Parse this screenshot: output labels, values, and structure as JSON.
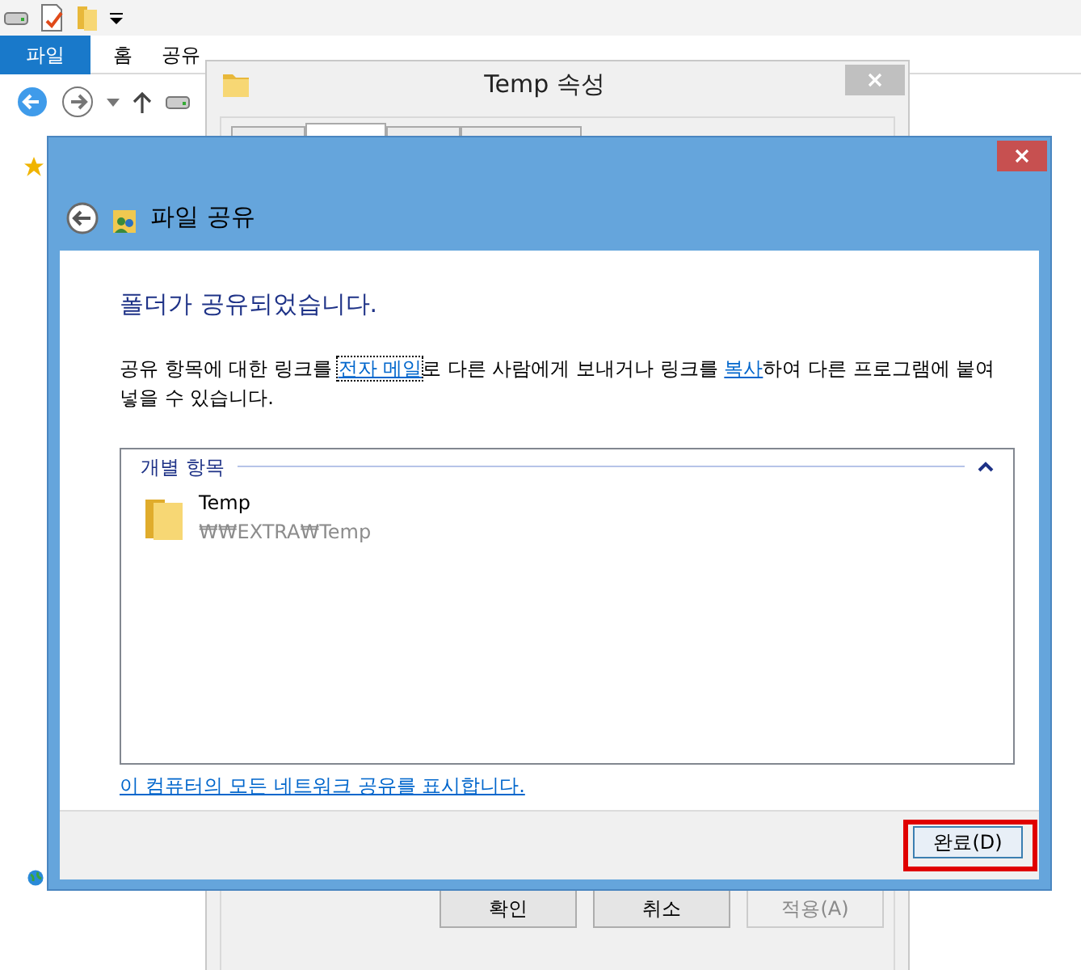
{
  "explorer": {
    "ribbon_tabs": [
      {
        "label": "파일",
        "selected": true
      },
      {
        "label": "홈",
        "selected": false
      },
      {
        "label": "공유",
        "selected": false
      }
    ]
  },
  "properties": {
    "title": "Temp 속성",
    "tabs": [
      {
        "selected": false
      },
      {
        "selected": true
      },
      {
        "selected": false
      },
      {
        "selected": false
      }
    ],
    "buttons": [
      {
        "label": "확인",
        "disabled": false
      },
      {
        "label": "취소",
        "disabled": false
      },
      {
        "label": "적용(A)",
        "disabled": true
      }
    ]
  },
  "sharing": {
    "title": "파일 공유",
    "heading": "폴더가 공유되었습니다.",
    "message": [
      {
        "kind": "text",
        "text": "공유 항목에 대한 링크를 "
      },
      {
        "kind": "link",
        "text": "전자 메일",
        "focused": true
      },
      {
        "kind": "text",
        "text": "로 다른 사람에게 보내거나 링크를 "
      },
      {
        "kind": "link",
        "text": "복사",
        "focused": false
      },
      {
        "kind": "text",
        "text": "하여 다른 프로그램에 붙여넣을 수 있습니다."
      }
    ],
    "group": {
      "label": "개별 항목",
      "expanded": true,
      "items": [
        {
          "name": "Temp",
          "path": "₩₩EXTRA₩Temp"
        }
      ]
    },
    "footer_link": "이 컴퓨터의 모든 네트워크 공유를 표시합니다.",
    "done_button": {
      "label": "완료(D)",
      "highlighted": true
    }
  }
}
